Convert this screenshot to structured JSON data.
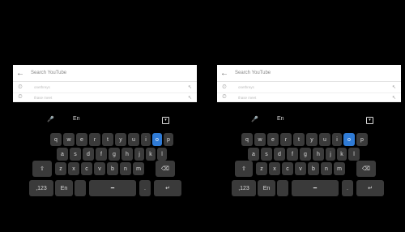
{
  "search": {
    "placeholder": "Search YouTube"
  },
  "suggestions": [
    {
      "text": "onethreys"
    },
    {
      "text": "thase meet"
    }
  ],
  "keyboard": {
    "language": "En",
    "row1": [
      "q",
      "w",
      "e",
      "r",
      "t",
      "y",
      "u",
      "i",
      "o",
      "p"
    ],
    "row2": [
      "a",
      "s",
      "d",
      "f",
      "g",
      "h",
      "j",
      "k",
      "l"
    ],
    "row3": [
      "z",
      "x",
      "c",
      "v",
      "b",
      "n",
      "m"
    ],
    "num_label": ",123",
    "lang_key": "En",
    "space_glyph": "━",
    "shift_glyph": "⇧",
    "backspace_glyph": "⌫",
    "enter_glyph": "↵",
    "dot_label": "."
  },
  "icons": {
    "back": "arrow-back",
    "history": "clock",
    "mic": "microphone",
    "hide": "keyboard-hide"
  },
  "colors": {
    "background": "#000000",
    "key": "#3a3a3a",
    "key_highlight": "#2f7bd6"
  }
}
